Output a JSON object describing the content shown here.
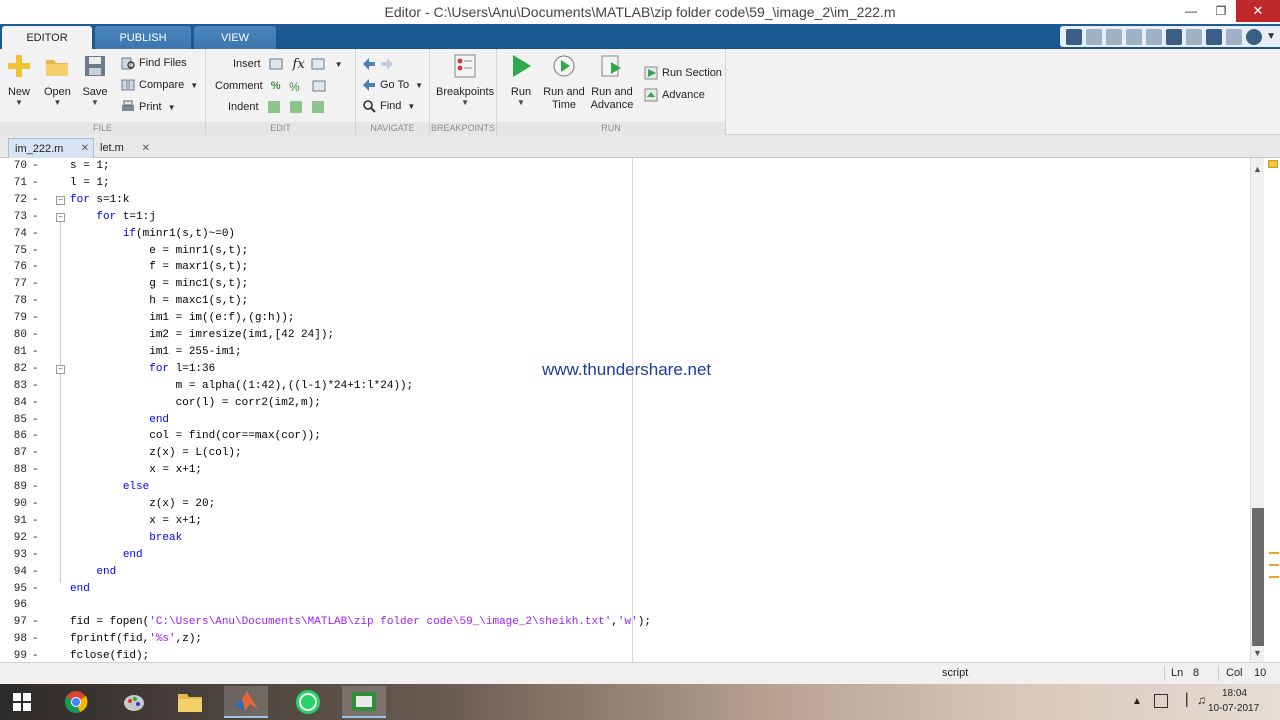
{
  "window": {
    "title": "Editor - C:\\Users\\Anu\\Documents\\MATLAB\\zip folder code\\59_\\image_2\\im_222.m"
  },
  "ribbon_tabs": [
    "EDITOR",
    "PUBLISH",
    "VIEW"
  ],
  "ribbon": {
    "file": {
      "label": "FILE",
      "new": "New",
      "open": "Open",
      "save": "Save",
      "find_files": "Find Files",
      "compare": "Compare",
      "print": "Print"
    },
    "edit": {
      "label": "EDIT",
      "insert": "Insert",
      "comment": "Comment",
      "indent": "Indent"
    },
    "navigate": {
      "label": "NAVIGATE",
      "go_to": "Go To",
      "find": "Find"
    },
    "breakpoints": {
      "label": "BREAKPOINTS",
      "button": "Breakpoints"
    },
    "run": {
      "label": "RUN",
      "run": "Run",
      "run_and_time": "Run and Time",
      "run_and_advance": "Run and Advance",
      "run_section": "Run Section",
      "advance": "Advance"
    }
  },
  "file_tabs": [
    "im_222.m",
    "let.m"
  ],
  "code_lines": [
    {
      "n": "70",
      "text": "s = 1;"
    },
    {
      "n": "71",
      "text": "l = 1;"
    },
    {
      "n": "72",
      "text": "for s=1:k"
    },
    {
      "n": "73",
      "text": "    for t=1:j"
    },
    {
      "n": "74",
      "text": "        if(minr1(s,t)~=0)"
    },
    {
      "n": "75",
      "text": "            e = minr1(s,t);"
    },
    {
      "n": "76",
      "text": "            f = maxr1(s,t);"
    },
    {
      "n": "77",
      "text": "            g = minc1(s,t);"
    },
    {
      "n": "78",
      "text": "            h = maxc1(s,t);"
    },
    {
      "n": "79",
      "text": "            im1 = im((e:f),(g:h));"
    },
    {
      "n": "80",
      "text": "            im2 = imresize(im1,[42 24]);"
    },
    {
      "n": "81",
      "text": "            im1 = 255-im1;"
    },
    {
      "n": "82",
      "text": "            for l=1:36"
    },
    {
      "n": "83",
      "text": "                m = alpha((1:42),((l-1)*24+1:l*24));"
    },
    {
      "n": "84",
      "text": "                cor(l) = corr2(im2,m);"
    },
    {
      "n": "85",
      "text": "            end"
    },
    {
      "n": "86",
      "text": "            col = find(cor==max(cor));"
    },
    {
      "n": "87",
      "text": "            z(x) = L(col);"
    },
    {
      "n": "88",
      "text": "            x = x+1;"
    },
    {
      "n": "89",
      "text": "        else"
    },
    {
      "n": "90",
      "text": "            z(x) = 20;"
    },
    {
      "n": "91",
      "text": "            x = x+1;"
    },
    {
      "n": "92",
      "text": "            break"
    },
    {
      "n": "93",
      "text": "        end"
    },
    {
      "n": "94",
      "text": "    end"
    },
    {
      "n": "95",
      "text": "end"
    },
    {
      "n": "96",
      "text": ""
    },
    {
      "n": "97",
      "text": "fid = fopen('C:\\Users\\Anu\\Documents\\MATLAB\\zip folder code\\59_\\image_2\\sheikh.txt','w');"
    },
    {
      "n": "98",
      "text": "fprintf(fid,'%s',z);"
    },
    {
      "n": "99",
      "text": "fclose(fid);"
    }
  ],
  "watermark": "www.thundershare.net",
  "status": {
    "mode": "script",
    "ln_label": "Ln",
    "ln": "8",
    "col_label": "Col",
    "col": "10"
  },
  "taskbar": {
    "time": "18:04",
    "date": "10-07-2017"
  },
  "colors": {
    "keyword": "#0000ff",
    "string": "#a020f0",
    "ribbon_blue": "#1d5c95"
  }
}
